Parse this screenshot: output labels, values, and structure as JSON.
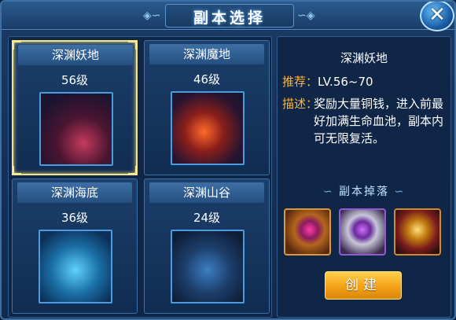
{
  "window": {
    "title": "副本选择",
    "close_symbol": "✕"
  },
  "dungeons": [
    {
      "name": "深渊妖地",
      "level": "56级",
      "selected": true
    },
    {
      "name": "深渊魔地",
      "level": "46级",
      "selected": false
    },
    {
      "name": "深渊海底",
      "level": "36级",
      "selected": false
    },
    {
      "name": "深渊山谷",
      "level": "24级",
      "selected": false
    }
  ],
  "detail": {
    "name": "深渊妖地",
    "recommend_label": "推荐：",
    "recommend_value": "LV.56~70",
    "desc_label": "描述：",
    "desc_value": "奖励大量铜钱，进入前最好加满生命血池，副本内可无限复活。"
  },
  "drops": {
    "title": "副本掉落",
    "items": [
      "treasure-chest-icon",
      "gem-bracer-icon",
      "golden-armor-icon"
    ]
  },
  "create_button": "创建",
  "colors": {
    "label": "#ffb33a",
    "selected_border": "#f3e38a",
    "button": "#f4a216"
  }
}
